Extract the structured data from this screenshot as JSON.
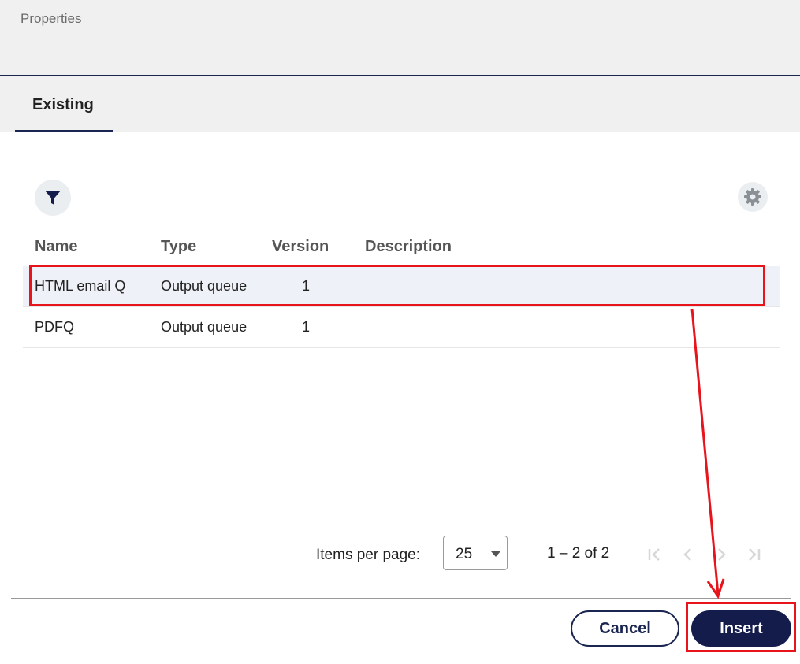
{
  "header": {
    "title": "Properties"
  },
  "tabs": [
    {
      "label": "Existing",
      "active": true
    }
  ],
  "toolbar": {
    "filter_icon": "filter-icon",
    "settings_icon": "gear-icon"
  },
  "table": {
    "columns": [
      "Name",
      "Type",
      "Version",
      "Description"
    ],
    "rows": [
      {
        "name": "HTML email Q",
        "type": "Output queue",
        "version": "1",
        "description": "",
        "selected": true
      },
      {
        "name": "PDFQ",
        "type": "Output queue",
        "version": "1",
        "description": "",
        "selected": false
      }
    ]
  },
  "pagination": {
    "items_per_page_label": "Items per page:",
    "items_per_page_value": "25",
    "range_label": "1 – 2 of 2"
  },
  "actions": {
    "cancel_label": "Cancel",
    "insert_label": "Insert"
  },
  "colors": {
    "brand": "#141c4b",
    "highlight": "#e8141c",
    "selected_row": "#eef1f7"
  }
}
